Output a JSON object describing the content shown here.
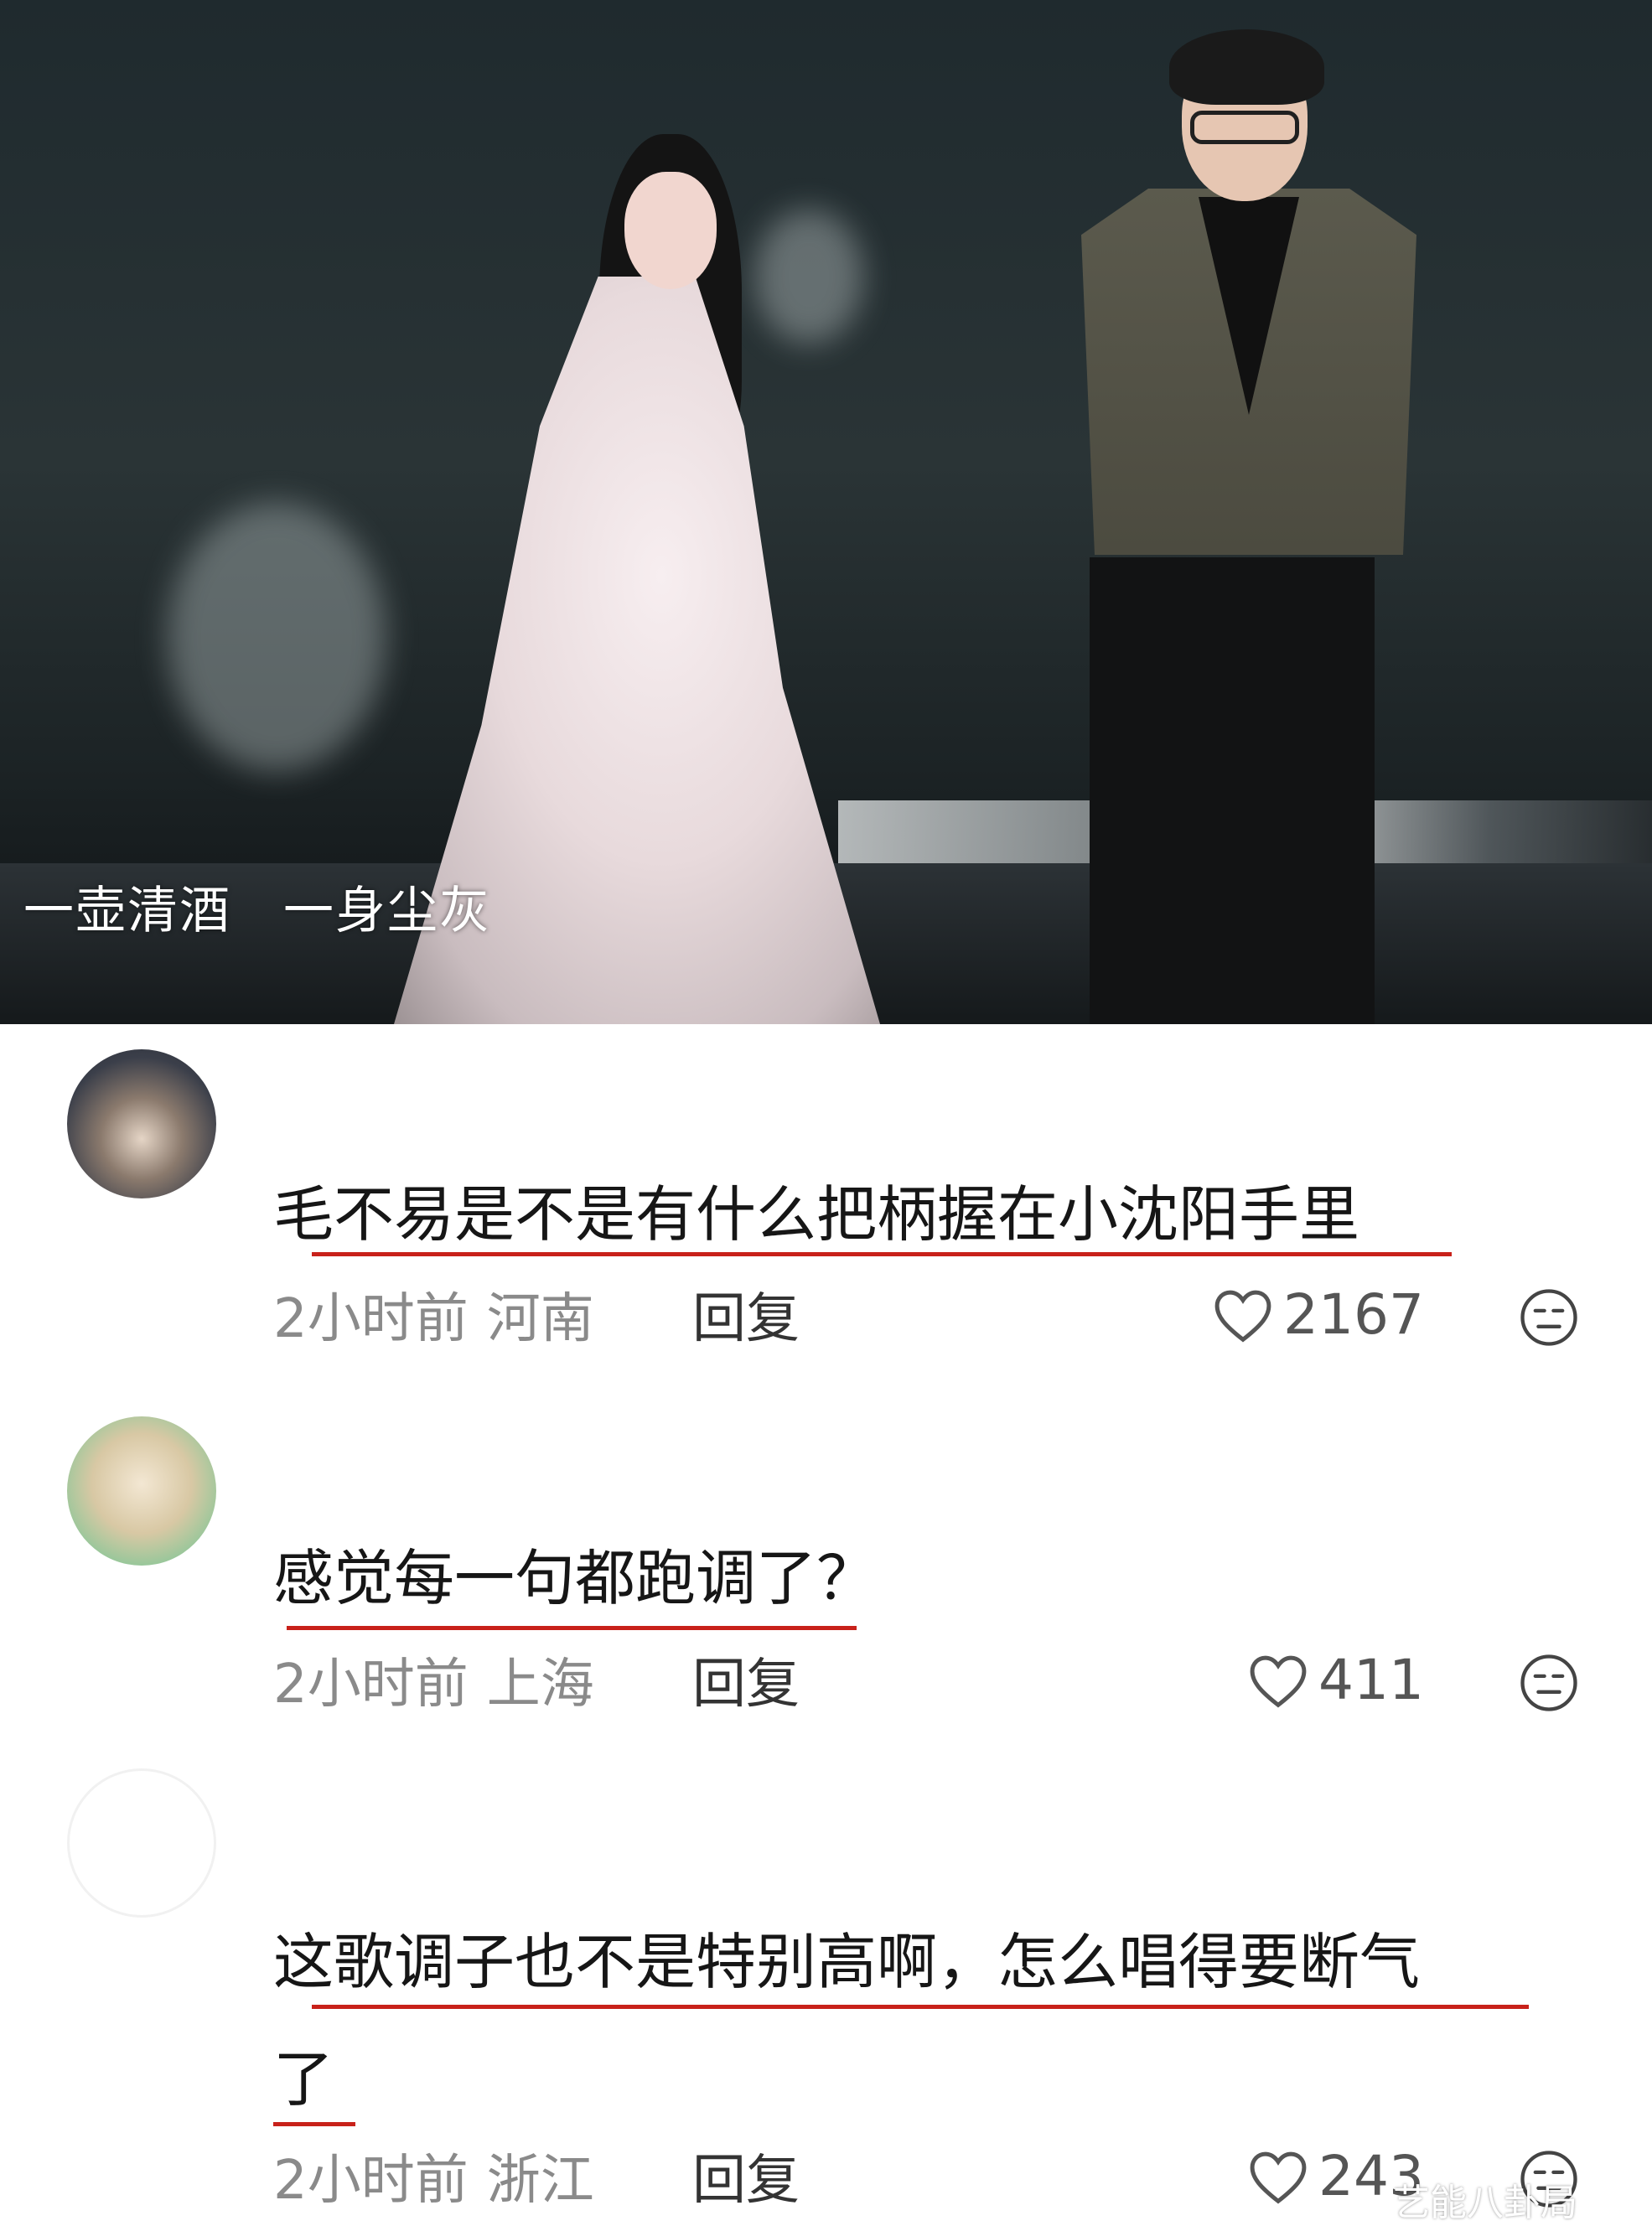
{
  "video": {
    "subtitle": "一壶清酒　一身尘灰"
  },
  "comments": [
    {
      "text": "毛不易是不是有什么把柄握在小沈阳手里",
      "time": "2小时前",
      "location": "河南",
      "reply_label": "回复",
      "likes": "2167"
    },
    {
      "text": "感觉每一句都跑调了？",
      "time": "2小时前",
      "location": "上海",
      "reply_label": "回复",
      "likes": "411"
    },
    {
      "text_line1": "这歌调子也不是特别高啊，怎么唱得要断气",
      "text_line2": "了",
      "time": "2小时前",
      "location": "浙江",
      "reply_label": "回复",
      "likes": "243"
    }
  ],
  "watermark": "艺能八卦局",
  "colors": {
    "underline": "#c8211a",
    "meta_text": "#8a8a8a",
    "comment_text": "#161616"
  }
}
